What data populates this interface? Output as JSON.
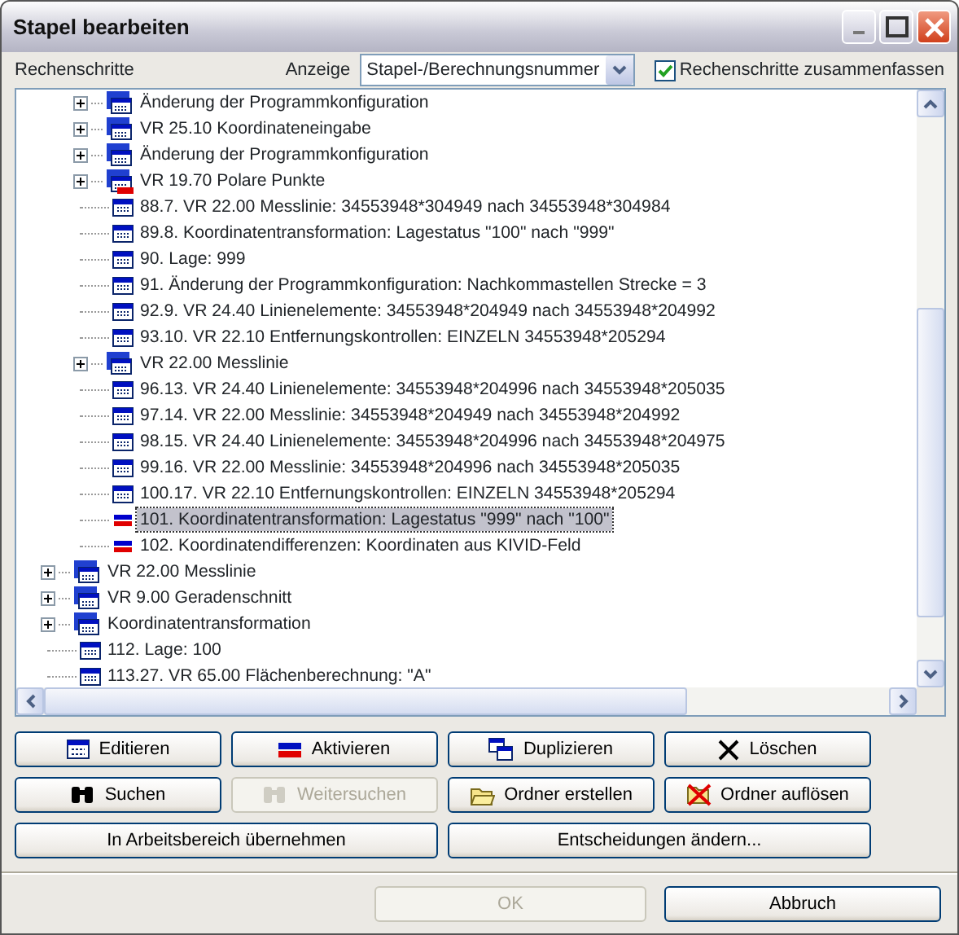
{
  "window": {
    "title": "Stapel bearbeiten"
  },
  "header": {
    "label": "Rechenschritte",
    "display_label": "Anzeige",
    "display_value": "Stapel-/Berechnungsnummer",
    "combine": {
      "label": "Rechenschritte zusammenfassen",
      "checked": true
    }
  },
  "tree": {
    "items": [
      {
        "kind": "group",
        "children": [
          {
            "kind": "folder",
            "label": "Änderung der Programmkonfiguration",
            "expanded": false,
            "active": false,
            "selected": false
          },
          {
            "kind": "folder",
            "label": "VR 25.10 Koordinateneingabe",
            "expanded": false,
            "active": false,
            "selected": false
          },
          {
            "kind": "folder",
            "label": "Änderung der Programmkonfiguration",
            "expanded": false,
            "active": false,
            "selected": false
          },
          {
            "kind": "folder",
            "label": "VR 19.70 Polare Punkte",
            "expanded": false,
            "active": true,
            "selected": false
          },
          {
            "kind": "step",
            "label": "88.7. VR 22.00 Messlinie: 34553948*304949 nach 34553948*304984",
            "active": false,
            "selected": false
          },
          {
            "kind": "step",
            "label": "89.8. Koordinatentransformation: Lagestatus \"100\" nach \"999\"",
            "active": false,
            "selected": false
          },
          {
            "kind": "step",
            "label": "90. Lage: 999",
            "active": false,
            "selected": false
          },
          {
            "kind": "step",
            "label": "91. Änderung der Programmkonfiguration: Nachkommastellen Strecke = 3",
            "active": false,
            "selected": false
          },
          {
            "kind": "step",
            "label": "92.9. VR 24.40 Linienelemente: 34553948*204949 nach 34553948*204992",
            "active": false,
            "selected": false
          },
          {
            "kind": "step",
            "label": "93.10. VR 22.10 Entfernungskontrollen: EINZELN 34553948*205294",
            "active": false,
            "selected": false
          },
          {
            "kind": "folder",
            "label": "VR 22.00 Messlinie",
            "expanded": false,
            "active": false,
            "selected": false
          },
          {
            "kind": "step",
            "label": "96.13. VR 24.40 Linienelemente: 34553948*204996 nach 34553948*205035",
            "active": false,
            "selected": false
          },
          {
            "kind": "step",
            "label": "97.14. VR 22.00 Messlinie: 34553948*204949 nach 34553948*204992",
            "active": false,
            "selected": false
          },
          {
            "kind": "step",
            "label": "98.15. VR 24.40 Linienelemente: 34553948*204996 nach 34553948*204975",
            "active": false,
            "selected": false
          },
          {
            "kind": "step",
            "label": "99.16. VR 22.00 Messlinie: 34553948*204996 nach 34553948*205035",
            "active": false,
            "selected": false
          },
          {
            "kind": "step",
            "label": "100.17. VR 22.10 Entfernungskontrollen: EINZELN 34553948*205294",
            "active": false,
            "selected": false
          },
          {
            "kind": "step",
            "label": "101. Koordinatentransformation: Lagestatus \"999\" nach \"100\"",
            "active": true,
            "selected": true
          },
          {
            "kind": "step",
            "label": "102. Koordinatendifferenzen: Koordinaten aus KIVID-Feld",
            "active": true,
            "selected": false
          }
        ]
      },
      {
        "kind": "folder",
        "label": "VR 22.00 Messlinie",
        "expanded": false,
        "active": false,
        "selected": false
      },
      {
        "kind": "folder",
        "label": "VR 9.00 Geradenschnitt",
        "expanded": false,
        "active": false,
        "selected": false
      },
      {
        "kind": "folder",
        "label": "Koordinatentransformation",
        "expanded": false,
        "active": false,
        "selected": false
      },
      {
        "kind": "step",
        "label": "112. Lage: 100",
        "active": false,
        "selected": false
      },
      {
        "kind": "step",
        "label": "113.27. VR 65.00 Flächenberechnung: \"A\"",
        "active": false,
        "selected": false
      }
    ]
  },
  "buttons": [
    {
      "label": "Editieren",
      "disabled": false
    },
    {
      "label": "Aktivieren",
      "disabled": false
    },
    {
      "label": "Duplizieren",
      "disabled": false
    },
    {
      "label": "Löschen",
      "disabled": false
    },
    {
      "label": "Suchen",
      "disabled": false
    },
    {
      "label": "Weitersuchen",
      "disabled": true
    },
    {
      "label": "Ordner erstellen",
      "disabled": false
    },
    {
      "label": "Ordner auflösen",
      "disabled": false
    },
    {
      "label": "In Arbeitsbereich übernehmen",
      "disabled": false
    },
    {
      "label": "Entscheidungen ändern...",
      "disabled": false
    }
  ],
  "footer": [
    {
      "label": "OK",
      "disabled": true
    },
    {
      "label": "Abbruch",
      "disabled": false
    }
  ]
}
